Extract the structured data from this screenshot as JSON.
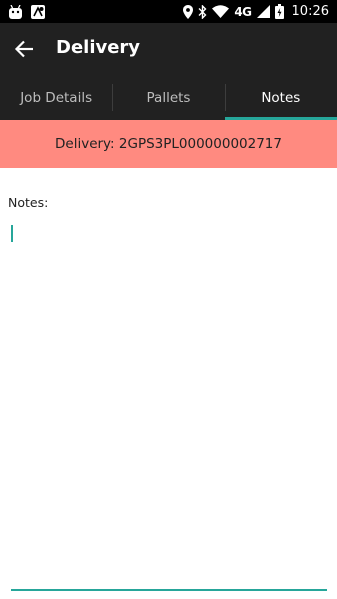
{
  "status_bar": {
    "network": "4G",
    "time": "10:26",
    "icons": [
      "android-icon",
      "map-icon",
      "location-icon",
      "bluetooth-icon",
      "wifi-icon",
      "cell-signal-icon",
      "battery-icon"
    ]
  },
  "app_bar": {
    "title": "Delivery"
  },
  "tabs": [
    {
      "label": "Job Details",
      "active": false
    },
    {
      "label": "Pallets",
      "active": false
    },
    {
      "label": "Notes",
      "active": true
    }
  ],
  "banner": {
    "text": "Delivery: 2GPS3PL000000002717"
  },
  "notes": {
    "label": "Notes:",
    "value": ""
  },
  "colors": {
    "accent": "#26a69a",
    "banner": "#ff8a80",
    "toolbar": "#212121"
  }
}
